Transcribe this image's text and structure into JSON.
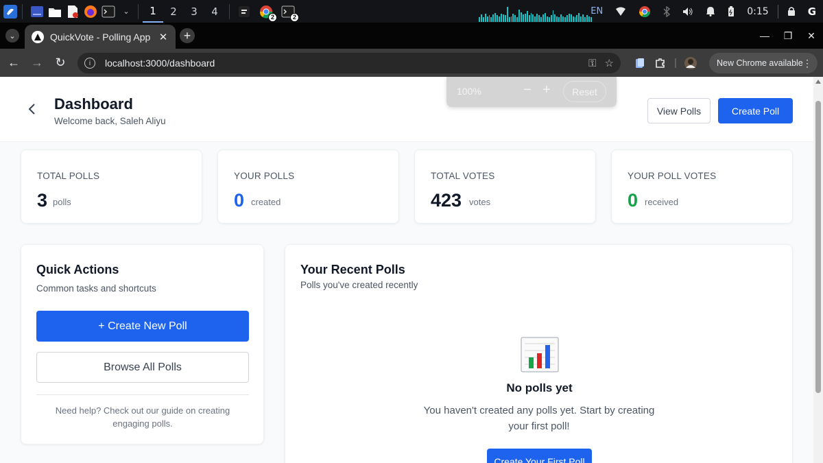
{
  "taskbar": {
    "workspaces": [
      "1",
      "2",
      "3",
      "4"
    ],
    "chrome_badge": "2",
    "terminal_badge": "2",
    "language": "EN",
    "clock": "0:15",
    "sysmon_levels": [
      0.3,
      0.45,
      0.3,
      0.5,
      0.35,
      0.4,
      0.3,
      0.45,
      0.55,
      0.4,
      0.35,
      0.5,
      0.45,
      0.4,
      0.9,
      0.3,
      0.35,
      0.5,
      0.4,
      0.3,
      0.75,
      0.6,
      0.45,
      0.5,
      0.65,
      0.4,
      0.55,
      0.45,
      0.35,
      0.5,
      0.4,
      0.3,
      0.45,
      0.55,
      0.35,
      0.3,
      0.4,
      0.7,
      0.45,
      0.35,
      0.3,
      0.45,
      0.35,
      0.3,
      0.4,
      0.5,
      0.45,
      0.35,
      0.3,
      0.4,
      0.55,
      0.35,
      0.45,
      0.3,
      0.4,
      0.35,
      0.3
    ]
  },
  "browser": {
    "tab_title": "QuickVote - Polling App",
    "url": "localhost:3000/dashboard",
    "update_label": "New Chrome available",
    "zoom": {
      "value": "100%",
      "minus": "−",
      "plus": "+",
      "reset": "Reset"
    }
  },
  "header": {
    "title": "Dashboard",
    "subtitle": "Welcome back, Saleh Aliyu",
    "view_polls": "View Polls",
    "create_poll": "Create Poll"
  },
  "stats": [
    {
      "label": "TOTAL POLLS",
      "value": "3",
      "unit": "polls",
      "color": "#111827"
    },
    {
      "label": "YOUR POLLS",
      "value": "0",
      "unit": "created",
      "color": "#1d63ed"
    },
    {
      "label": "TOTAL VOTES",
      "value": "423",
      "unit": "votes",
      "color": "#111827"
    },
    {
      "label": "YOUR POLL VOTES",
      "value": "0",
      "unit": "received",
      "color": "#16a34a"
    }
  ],
  "quick_actions": {
    "title": "Quick Actions",
    "subtitle": "Common tasks and shortcuts",
    "create_new": "+ Create New Poll",
    "browse_all": "Browse All Polls",
    "help": "Need help? Check out our guide on creating engaging polls."
  },
  "recent_polls": {
    "title": "Your Recent Polls",
    "subtitle": "Polls you've created recently",
    "empty_icon": "bar-chart-icon",
    "empty_title": "No polls yet",
    "empty_text": "You haven't created any polls yet. Start by creating your first poll!",
    "empty_button": "Create Your First Poll"
  },
  "colors": {
    "primary": "#1d63ed",
    "success": "#16a34a",
    "sysmon": "#19c3c6"
  }
}
